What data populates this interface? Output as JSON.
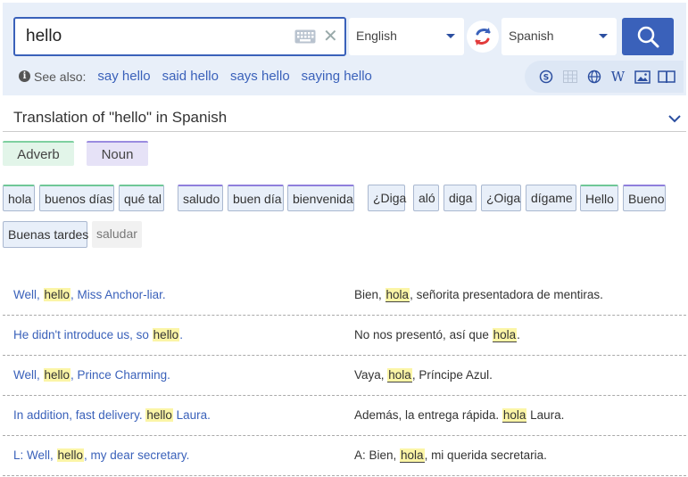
{
  "search": {
    "query": "hello"
  },
  "languages": {
    "from": "English",
    "to": "Spanish"
  },
  "see_also": {
    "label": "See also:",
    "links": [
      "say hello",
      "said hello",
      "says hello",
      "saying hello"
    ]
  },
  "translation_title": "Translation of \"hello\" in Spanish",
  "pos_tags": [
    "Adverb",
    "Noun"
  ],
  "translations": [
    "hola",
    "buenos días",
    "qué tal",
    "saludo",
    "buen día",
    "bienvenida",
    "¿Diga",
    "aló",
    "diga",
    "¿Oiga",
    "dígame",
    "Hello",
    "Bueno",
    "Buenas tardes",
    "saludar"
  ],
  "examples": [
    {
      "src_pre": "Well, ",
      "src_hl": "hello",
      "src_post": ", Miss Anchor-liar.",
      "tgt_pre": "Bien, ",
      "tgt_hl": "hola",
      "tgt_post": ", señorita presentadora de mentiras."
    },
    {
      "src_pre": "He didn't introduce us, so ",
      "src_hl": "hello",
      "src_post": ".",
      "tgt_pre": "No nos presentó, así que ",
      "tgt_hl": "hola",
      "tgt_post": "."
    },
    {
      "src_pre": "Well, ",
      "src_hl": "hello",
      "src_post": ", Prince Charming.",
      "tgt_pre": "Vaya, ",
      "tgt_hl": "hola",
      "tgt_post": ", Príncipe Azul."
    },
    {
      "src_pre": "In addition, fast delivery. ",
      "src_hl": "hello",
      "src_post": " Laura.",
      "tgt_pre": "Además, la entrega rápida. ",
      "tgt_hl": "hola",
      "tgt_post": " Laura."
    },
    {
      "src_pre": "L: Well, ",
      "src_hl": "hello",
      "src_post": ", my dear secretary.",
      "tgt_pre": "A: Bien, ",
      "tgt_hl": "hola",
      "tgt_post": ", mi querida secretaria."
    }
  ],
  "icons": {
    "tools": [
      "skype-icon",
      "grid-icon",
      "globe-icon",
      "wikipedia-icon",
      "image-icon",
      "book-icon"
    ],
    "accent": "#3a61ba"
  }
}
